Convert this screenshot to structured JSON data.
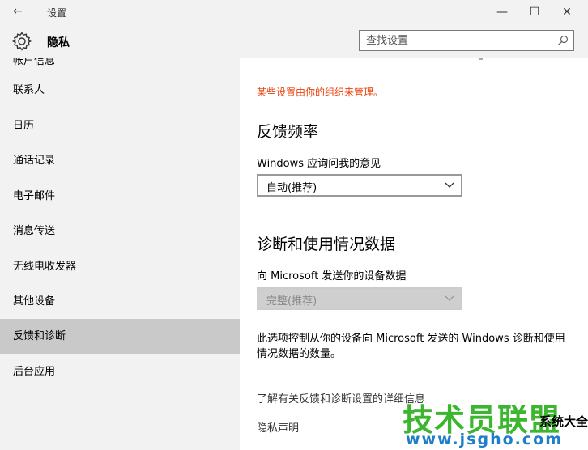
{
  "titlebar": {
    "back_icon": "back-arrow-icon",
    "title": "设置",
    "minimize": "—",
    "maximize": "☐",
    "close": "✕"
  },
  "header": {
    "icon": "gear-icon",
    "title": "隐私",
    "search_placeholder": "查找设置",
    "search_icon": "search-icon"
  },
  "sidebar": {
    "cut_item": "帐户信息",
    "items": [
      {
        "label": "联系人",
        "selected": false
      },
      {
        "label": "日历",
        "selected": false
      },
      {
        "label": "通话记录",
        "selected": false
      },
      {
        "label": "电子邮件",
        "selected": false
      },
      {
        "label": "消息传送",
        "selected": false
      },
      {
        "label": "无线电收发器",
        "selected": false
      },
      {
        "label": "其他设备",
        "selected": false
      },
      {
        "label": "反馈和诊断",
        "selected": true
      },
      {
        "label": "后台应用",
        "selected": false
      }
    ]
  },
  "content": {
    "managed_notice": "某些设置由你的组织来管理。",
    "feedback": {
      "heading": "反馈频率",
      "label": "Windows 应询问我的意见",
      "selected": "自动(推荐)"
    },
    "diagnostics": {
      "heading": "诊断和使用情况数据",
      "label": "向 Microsoft 发送你的设备数据",
      "selected": "完整(推荐)"
    },
    "description": "此选项控制从你的设备向 Microsoft 发送的 Windows 诊断和使用情况数据的数量。",
    "links": [
      "了解有关反馈和诊断设置的详细信息",
      "隐私声明"
    ]
  },
  "watermark": {
    "main": "技术员联盟",
    "side": "系统大全",
    "url": "www.jsgho.com"
  },
  "colors": {
    "accent_warning": "#e8430c",
    "sidebar_bg": "#f2f2f2",
    "selected_bg": "#c9c9c9"
  }
}
